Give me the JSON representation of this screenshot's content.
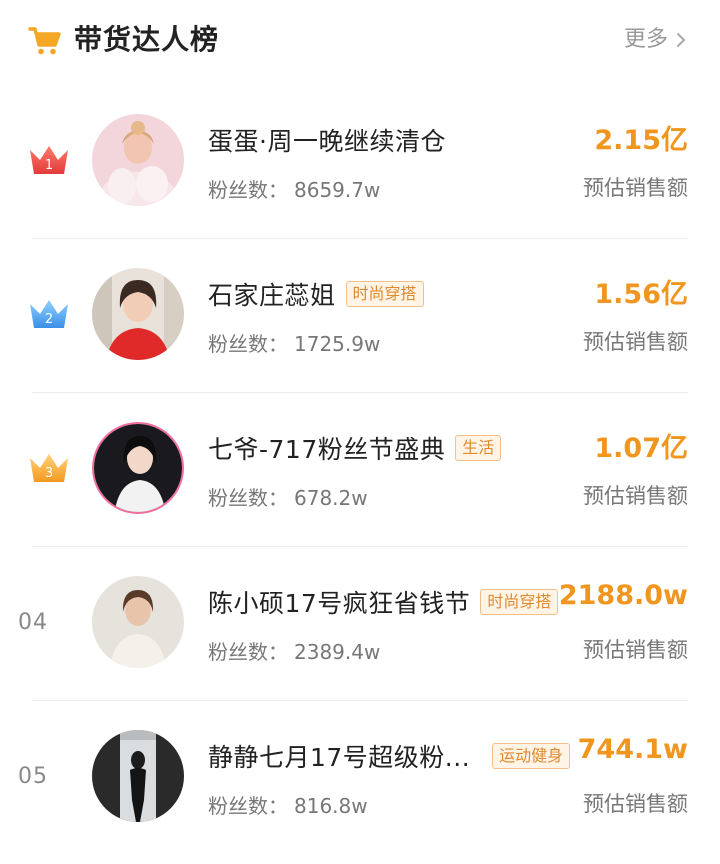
{
  "header": {
    "title": "带货达人榜",
    "more_label": "更多",
    "icon": "shopping-cart-icon",
    "icon_color": "#f5a623"
  },
  "colors": {
    "amount": "#f0961e",
    "tag_text": "#e08a2e",
    "crown_gold": "#e84545",
    "crown_silver": "#4aa3f0",
    "crown_bronze": "#f5a623"
  },
  "rankings": [
    {
      "rank": "1",
      "rank_icon": "crown-red-icon",
      "name": "蛋蛋·周一晚继续清仓",
      "tag": "",
      "fans_label": "粉丝数：",
      "fans_value": "8659.7w",
      "amount": "2.15亿",
      "amount_label": "预估销售额"
    },
    {
      "rank": "2",
      "rank_icon": "crown-blue-icon",
      "name": "石家庄蕊姐",
      "tag": "时尚穿搭",
      "fans_label": "粉丝数：",
      "fans_value": "1725.9w",
      "amount": "1.56亿",
      "amount_label": "预估销售额"
    },
    {
      "rank": "3",
      "rank_icon": "crown-gold-icon",
      "name": "七爷-717粉丝节盛典",
      "tag": "生活",
      "fans_label": "粉丝数：",
      "fans_value": "678.2w",
      "amount": "1.07亿",
      "amount_label": "预估销售额"
    },
    {
      "rank": "04",
      "rank_icon": "",
      "name": "陈小硕17号疯狂省钱节",
      "tag": "时尚穿搭",
      "fans_label": "粉丝数：",
      "fans_value": "2389.4w",
      "amount": "2188.0w",
      "amount_label": "预估销售额"
    },
    {
      "rank": "05",
      "rank_icon": "",
      "name": "静静七月17号超级粉...",
      "tag": "运动健身",
      "fans_label": "粉丝数：",
      "fans_value": "816.8w",
      "amount": "744.1w",
      "amount_label": "预估销售额"
    }
  ]
}
